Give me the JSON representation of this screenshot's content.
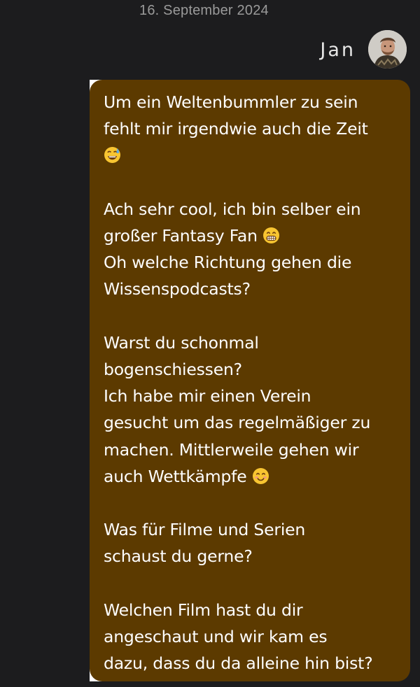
{
  "chat": {
    "date": "16. September 2024",
    "sender": "Jan",
    "colors": {
      "background": "#1c1c1e",
      "bubble": "#5c3a00",
      "text": "#ffffff",
      "date": "#9a9a9a"
    }
  },
  "message": {
    "p1_text": "Um ein Weltenbummler zu sein\nfehlt mir irgendwie auch die Zeit\n",
    "p1_emoji": "smiling-face-sweat-icon",
    "p2_line1": "Ach sehr cool, ich bin selber ein\ngroßer Fantasy Fan ",
    "p2_emoji": "grinning-face-icon",
    "p2_line2": "\nOh welche Richtung gehen die\nWissenspodcasts?",
    "p3_text": "Warst du schonmal\nbogenschiessen?\nIch habe mir einen Verein\ngesucht um das regelmäßiger zu\nmachen. Mittlerweile gehen wir\nauch Wettkämpfe ",
    "p3_emoji": "smiling-face-icon",
    "p4_text": "Was für Filme und Serien\nschaust du gerne?",
    "p5_text": "Welchen Film hast du dir\nangeschaut und wir kam es\ndazu, dass du da alleine hin bist?"
  }
}
